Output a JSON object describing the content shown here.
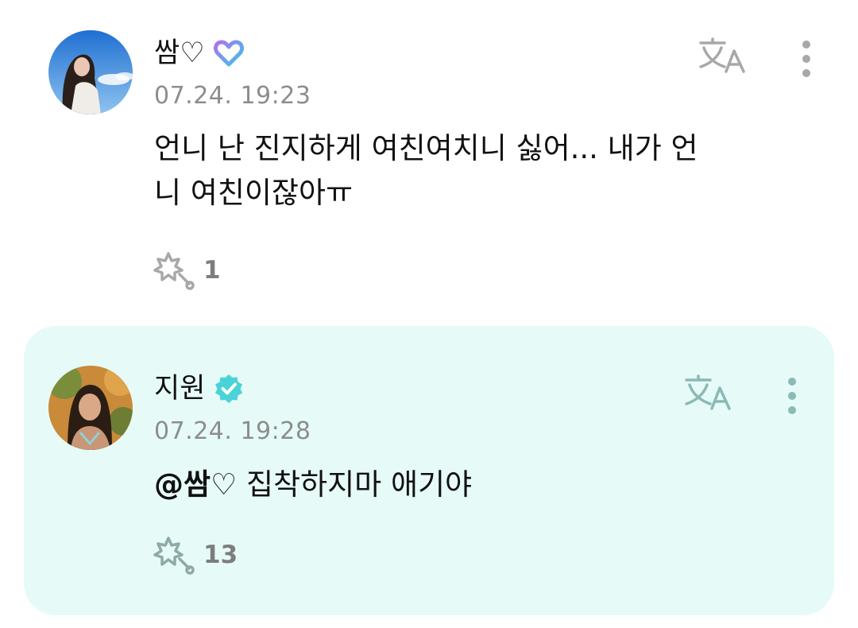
{
  "comments": [
    {
      "author": "쌈♡",
      "badge": "membership-heart-icon",
      "timestamp": "07.24. 19:23",
      "text_lines": [
        "언니 난 진지하게 여친여치니 싫어... 내가 언",
        "니 여친이잖아ㅠ"
      ],
      "like_count": "1"
    },
    {
      "author": "지원",
      "badge": "verified-check-icon",
      "timestamp": "07.24. 19:28",
      "mention": "@쌈♡",
      "text": " 집착하지마 애기야",
      "like_count": "13"
    }
  ],
  "colors": {
    "reply_background": "#e6fbf7",
    "verified": "#49d3d8",
    "icon_gray": "#a8a8a8",
    "icon_teal": "#8bb9b6"
  }
}
